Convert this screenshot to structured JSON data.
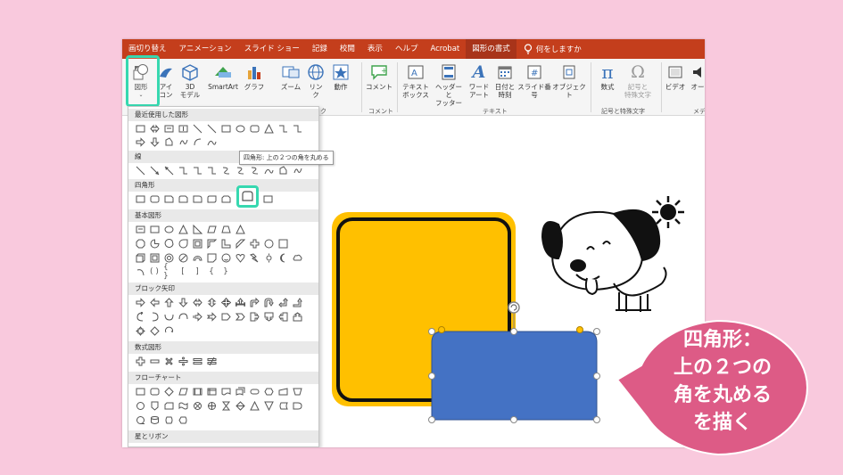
{
  "tabs": [
    "画切り替え",
    "アニメーション",
    "スライド ショー",
    "記録",
    "校閲",
    "表示",
    "ヘルプ",
    "Acrobat",
    "図形の書式"
  ],
  "active_tab": "図形の書式",
  "tell_me": "何をしますか",
  "ribbon": {
    "buttons": [
      {
        "name": "shapes-button",
        "label": "図形",
        "icon": "shapes-icon"
      },
      {
        "name": "icons-button",
        "label": "アイ\nコン",
        "icon": "icons-icon"
      },
      {
        "name": "3d-model-button",
        "label": "3D\nモデル",
        "icon": "cube-icon"
      },
      {
        "name": "smartart-button",
        "label": "SmartArt",
        "icon": "smartart-icon"
      },
      {
        "name": "graph-button",
        "label": "グラフ",
        "icon": "chart-icon"
      },
      {
        "name": "zoom-button",
        "label": "ズーム",
        "icon": "zoom-icon"
      },
      {
        "name": "link-button",
        "label": "リン\nク",
        "icon": "globe-icon"
      },
      {
        "name": "action-button",
        "label": "動作",
        "icon": "star-icon"
      },
      {
        "name": "comment-button",
        "label": "コメント",
        "icon": "comment-icon"
      },
      {
        "name": "textbox-button",
        "label": "テキスト\nボックス",
        "icon": "textbox-icon"
      },
      {
        "name": "header-footer-button",
        "label": "ヘッダーと\nフッター",
        "icon": "header-icon"
      },
      {
        "name": "wordart-button",
        "label": "ワード\nアート",
        "icon": "wordart-icon"
      },
      {
        "name": "datetime-button",
        "label": "日付と\n時刻",
        "icon": "calendar-icon"
      },
      {
        "name": "slide-number-button",
        "label": "スライド番号",
        "icon": "hash-icon"
      },
      {
        "name": "object-button",
        "label": "オブジェクト",
        "icon": "object-icon"
      },
      {
        "name": "equation-button",
        "label": "数式",
        "icon": "pi-icon"
      },
      {
        "name": "symbol-button",
        "label": "記号と\n特殊文字",
        "icon": "omega-icon"
      },
      {
        "name": "video-button",
        "label": "ビデオ",
        "icon": "video-icon"
      },
      {
        "name": "audio-button",
        "label": "オー",
        "icon": "audio-icon"
      }
    ],
    "groups": [
      "ク",
      "コメント",
      "テキスト",
      "記号と特殊文字",
      "メデ"
    ]
  },
  "gallery": {
    "categories": [
      "最近使用した図形",
      "線",
      "四角形",
      "基本図形",
      "ブロック矢印",
      "数式図形",
      "フローチャート",
      "星とリボン"
    ],
    "tooltip": "四角形: 上の２つの角を丸める"
  },
  "callout": {
    "lines": [
      "四角形：",
      "上の２つの",
      "角を丸める",
      "を描く"
    ]
  },
  "colors": {
    "accent_tab": "#c43e1c",
    "highlight": "#37d8b0",
    "orange": "#ffc000",
    "blue": "#4472c4",
    "callout": "#dd5b86"
  }
}
